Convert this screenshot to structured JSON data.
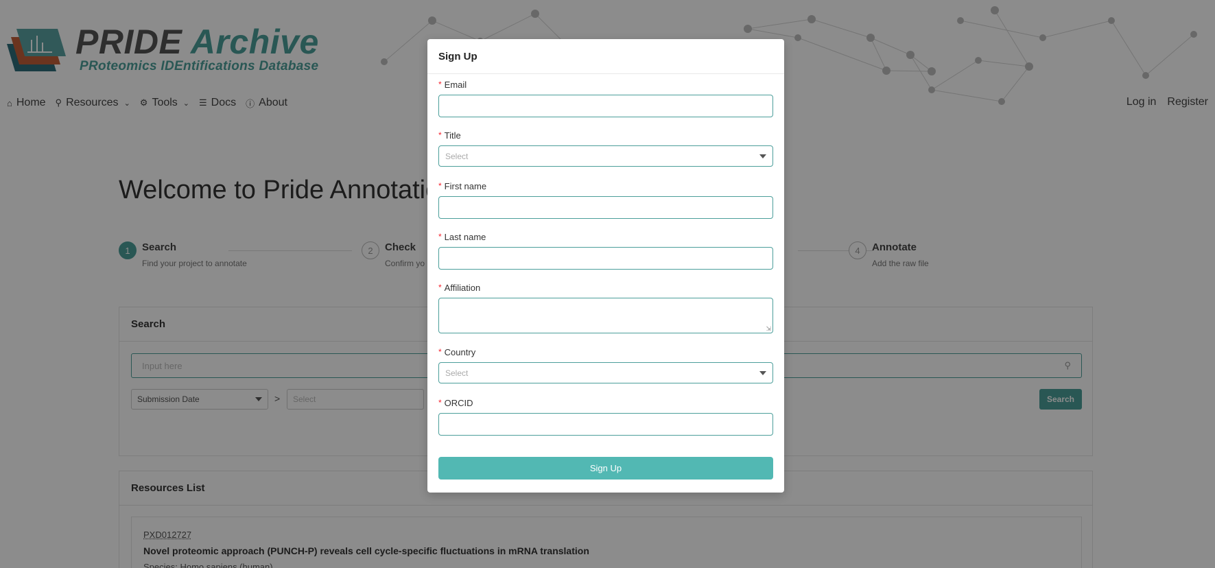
{
  "logo": {
    "title_part1": "PRIDE",
    "title_part2": "Archive",
    "subtitle": "PRoteomics IDEntifications Database"
  },
  "nav": {
    "items": [
      {
        "label": "Home",
        "icon": "home-icon"
      },
      {
        "label": "Resources",
        "icon": "search-icon",
        "dropdown": true
      },
      {
        "label": "Tools",
        "icon": "cogs-icon",
        "dropdown": true
      },
      {
        "label": "Docs",
        "icon": "graduation-cap-icon"
      },
      {
        "label": "About",
        "icon": "info-icon"
      }
    ],
    "login": "Log in",
    "register": "Register"
  },
  "main": {
    "welcome": "Welcome to Pride Annotation",
    "steps": [
      {
        "num": "1",
        "title": "Search",
        "desc": "Find your project to annotate",
        "active": true
      },
      {
        "num": "2",
        "title": "Check",
        "desc": "Confirm yo",
        "active": false
      },
      {
        "num": "4",
        "title": "Annotate",
        "desc": "Add the raw file",
        "active": false
      }
    ],
    "search_card": {
      "title": "Search",
      "input_placeholder": "Input here",
      "filter_field": "Submission Date",
      "operator": ">",
      "filter_value_placeholder": "Select",
      "search_button": "Search"
    },
    "resources_card": {
      "title": "Resources List",
      "item": {
        "accession": "PXD012727",
        "title": "Novel proteomic approach (PUNCH-P) reveals cell cycle-specific fluctuations in mRNA translation",
        "species": "Species: Homo sapiens (human)"
      }
    }
  },
  "modal": {
    "title": "Sign Up",
    "required_mark": "*",
    "fields": {
      "email": "Email",
      "title": "Title",
      "title_placeholder": "Select",
      "first_name": "First name",
      "last_name": "Last name",
      "affiliation": "Affiliation",
      "country": "Country",
      "country_placeholder": "Select",
      "orcid": "ORCID"
    },
    "submit": "Sign Up"
  },
  "colors": {
    "accent": "#4b9e9a",
    "button": "#52b8b3",
    "required": "#f5222d"
  }
}
